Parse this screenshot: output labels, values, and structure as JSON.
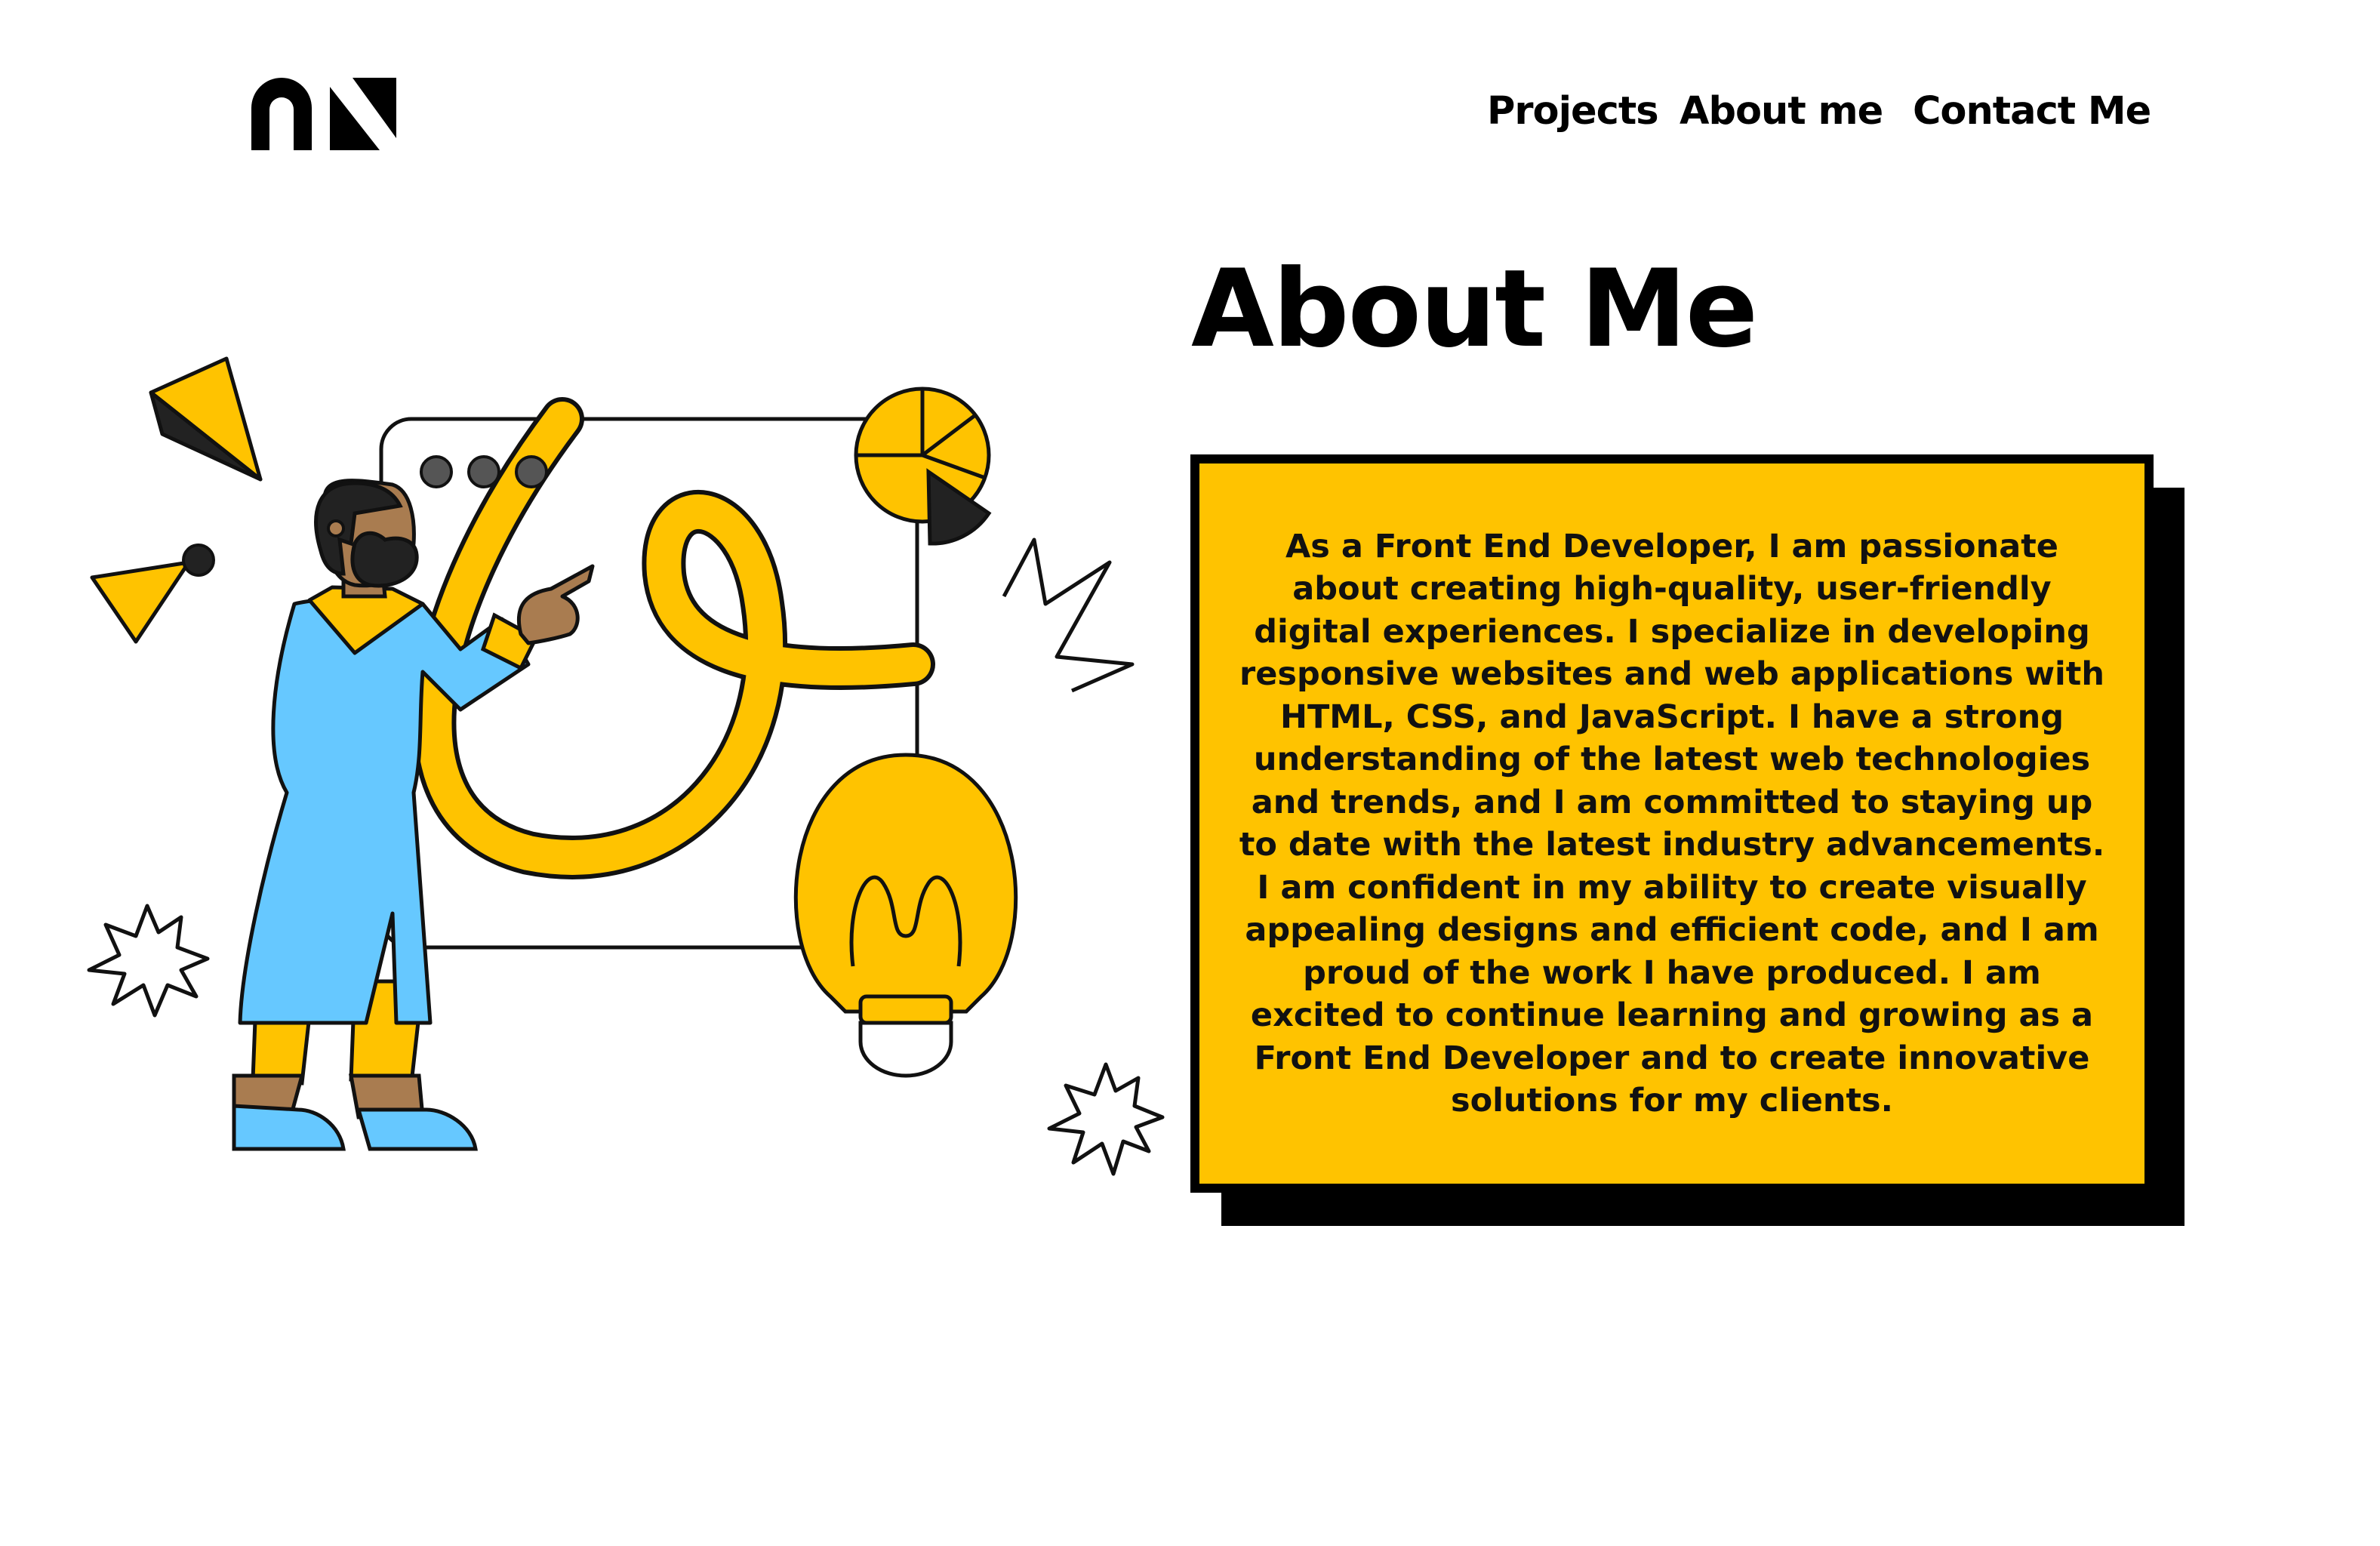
{
  "brand": {
    "logo_text": "ns"
  },
  "nav": {
    "items": [
      {
        "label": "Projects"
      },
      {
        "label": "About me"
      },
      {
        "label": "Contact Me"
      }
    ]
  },
  "about": {
    "title": "About Me",
    "body": "As a Front End Developer, I am passionate about creating high-quality, user-friendly digital experiences. I specialize in developing responsive websites and web applications with HTML, CSS, and JavaScript. I have a strong understanding of the latest web technologies and trends, and I am committed to staying up to date with the latest industry advancements. I am confident in my ability to create visually appealing designs and efficient code, and I am proud of the work I have produced. I am excited to continue learning and growing as a Front End Developer and to create innovative solutions for my clients."
  },
  "illustration": {
    "icons": [
      "person-icon",
      "whiteboard-icon",
      "pie-chart-icon",
      "lightbulb-icon",
      "triangle-icon",
      "starburst-icon",
      "zigzag-icon"
    ]
  },
  "colors": {
    "accent": "#ffc300",
    "shirt": "#66c8ff",
    "skin": "#a97c50",
    "outline": "#111111",
    "background": "#ffffff"
  }
}
